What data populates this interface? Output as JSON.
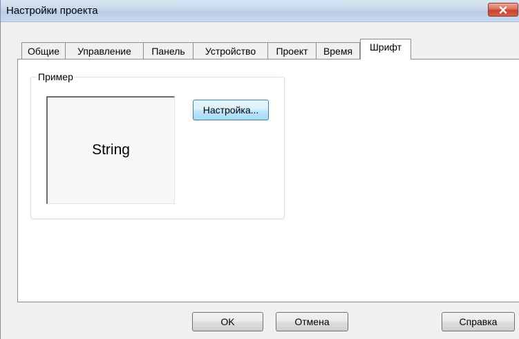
{
  "window": {
    "title": "Настройки проекта",
    "close_icon": "close-icon"
  },
  "tabs": [
    {
      "label": "Общие",
      "active": false
    },
    {
      "label": "Управление",
      "active": false
    },
    {
      "label": "Панель",
      "active": false
    },
    {
      "label": "Устройство",
      "active": false
    },
    {
      "label": "Проект",
      "active": false
    },
    {
      "label": "Время",
      "active": false
    },
    {
      "label": "Шрифт",
      "active": true
    }
  ],
  "font_tab": {
    "group_label": "Пример",
    "preview_text": "String",
    "settings_button": "Настройка..."
  },
  "footer": {
    "ok_label": "OK",
    "cancel_label": "Отмена",
    "help_label": "Справка"
  },
  "colors": {
    "dialog_bg": "#f0f0f0",
    "close_button": "#c7432a",
    "focus_button_border": "#3c7fb1"
  }
}
